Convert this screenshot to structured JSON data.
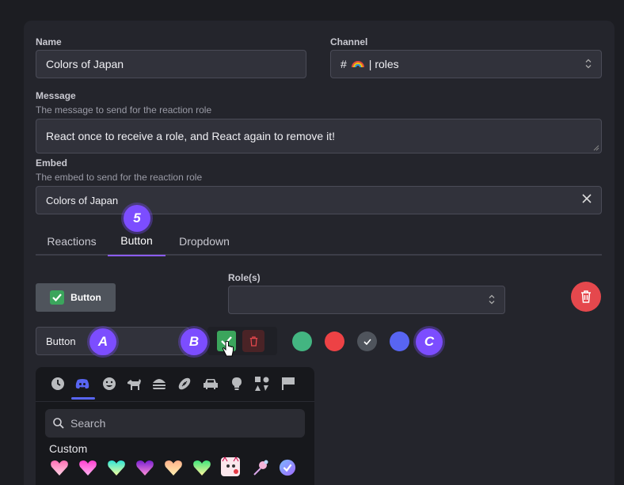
{
  "form": {
    "name_label": "Name",
    "name_value": "Colors of Japan",
    "channel_label": "Channel",
    "channel_hash": "#",
    "channel_emoji": "🌈",
    "channel_value": "| roles",
    "message_label": "Message",
    "message_hint": "The message to send for the reaction role",
    "message_value": "React once to receive a role, and React again to remove it!",
    "embed_label": "Embed",
    "embed_hint": "The embed to send for the reaction role",
    "embed_value": "Colors of Japan"
  },
  "tabs": [
    "Reactions",
    "Button",
    "Dropdown"
  ],
  "active_tab": "Button",
  "button_editor": {
    "preview_label": "Button",
    "preview_emoji": "✅",
    "roles_label": "Role(s)",
    "label_input_value": "Button"
  },
  "annotations": {
    "five": "5",
    "a": "A",
    "b": "B",
    "c": "C"
  },
  "style_colors": {
    "green": "#43b581",
    "red": "#ed4245",
    "grey": "#4f545c",
    "blurple": "#5865f2"
  },
  "picker": {
    "categories": [
      "clock-icon",
      "discord-icon",
      "smiley-icon",
      "dog-icon",
      "burger-icon",
      "football-icon",
      "car-icon",
      "lightbulb-icon",
      "symbols-icon",
      "flag-icon"
    ],
    "search_placeholder": "Search",
    "section_title": "Custom"
  },
  "accent": "#8b5cf6"
}
